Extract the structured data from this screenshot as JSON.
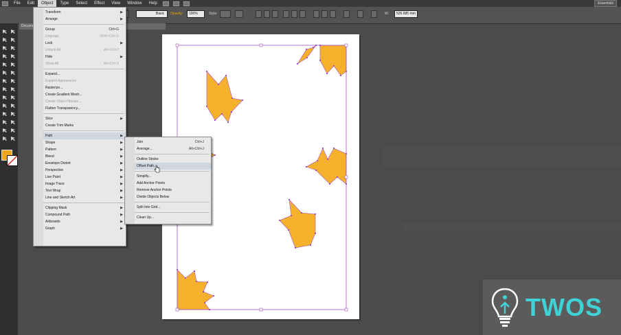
{
  "menubar": {
    "items": [
      "File",
      "Edit",
      "Object",
      "Type",
      "Select",
      "Effect",
      "View",
      "Window",
      "Help"
    ],
    "active": "Object",
    "workspace": "Essentials"
  },
  "control_bar": {
    "stroke_style": "Basic",
    "opacity_label": "Opacity:",
    "opacity_value": "100%",
    "style_label": "Style:",
    "w_label": "W:",
    "w_value": "526.685 mm"
  },
  "document_tab": "Document @ 50% (CMYK/Preview)",
  "object_menu": [
    {
      "label": "Transform",
      "submenu": true
    },
    {
      "label": "Arrange",
      "submenu": true
    },
    {
      "sep": true
    },
    {
      "label": "Group",
      "shortcut": "Ctrl+G"
    },
    {
      "label": "Ungroup",
      "shortcut": "Shift+Ctrl+G",
      "disabled": true
    },
    {
      "label": "Lock",
      "submenu": true
    },
    {
      "label": "Unlock All",
      "shortcut": "Alt+Ctrl+2",
      "disabled": true
    },
    {
      "label": "Hide",
      "submenu": true
    },
    {
      "label": "Show All",
      "shortcut": "Alt+Ctrl+3",
      "disabled": true
    },
    {
      "sep": true
    },
    {
      "label": "Expand..."
    },
    {
      "label": "Expand Appearance",
      "disabled": true
    },
    {
      "label": "Rasterize..."
    },
    {
      "label": "Create Gradient Mesh..."
    },
    {
      "label": "Create Object Mosaic...",
      "disabled": true
    },
    {
      "label": "Flatten Transparency..."
    },
    {
      "sep": true
    },
    {
      "label": "Slice",
      "submenu": true
    },
    {
      "label": "Create Trim Marks"
    },
    {
      "sep": true
    },
    {
      "label": "Path",
      "submenu": true,
      "highlighted": true
    },
    {
      "label": "Shape",
      "submenu": true
    },
    {
      "label": "Pattern",
      "submenu": true
    },
    {
      "label": "Blend",
      "submenu": true
    },
    {
      "label": "Envelope Distort",
      "submenu": true
    },
    {
      "label": "Perspective",
      "submenu": true
    },
    {
      "label": "Live Paint",
      "submenu": true
    },
    {
      "label": "Image Trace",
      "submenu": true
    },
    {
      "label": "Text Wrap",
      "submenu": true
    },
    {
      "label": "Line and Sketch Art",
      "submenu": true
    },
    {
      "sep": true
    },
    {
      "label": "Clipping Mask",
      "submenu": true
    },
    {
      "label": "Compound Path",
      "submenu": true
    },
    {
      "label": "Artboards",
      "submenu": true
    },
    {
      "label": "Graph",
      "submenu": true
    }
  ],
  "path_submenu": [
    {
      "label": "Join",
      "shortcut": "Ctrl+J"
    },
    {
      "label": "Average...",
      "shortcut": "Alt+Ctrl+J"
    },
    {
      "sep": true
    },
    {
      "label": "Outline Stroke"
    },
    {
      "label": "Offset Path...",
      "highlighted": true
    },
    {
      "sep": true
    },
    {
      "label": "Simplify..."
    },
    {
      "label": "Add Anchor Points"
    },
    {
      "label": "Remove Anchor Points"
    },
    {
      "label": "Divide Objects Below"
    },
    {
      "sep": true
    },
    {
      "label": "Split Into Grid..."
    },
    {
      "sep": true
    },
    {
      "label": "Clean Up..."
    }
  ],
  "colors": {
    "fill_swatch": "#f2a81d",
    "shape_fill": "#f5b02c",
    "selection": "#a24fc4",
    "logo_accent": "#3fd2d6"
  },
  "logo": {
    "text": "TWOS",
    "icon": "lightbulb-icon"
  }
}
